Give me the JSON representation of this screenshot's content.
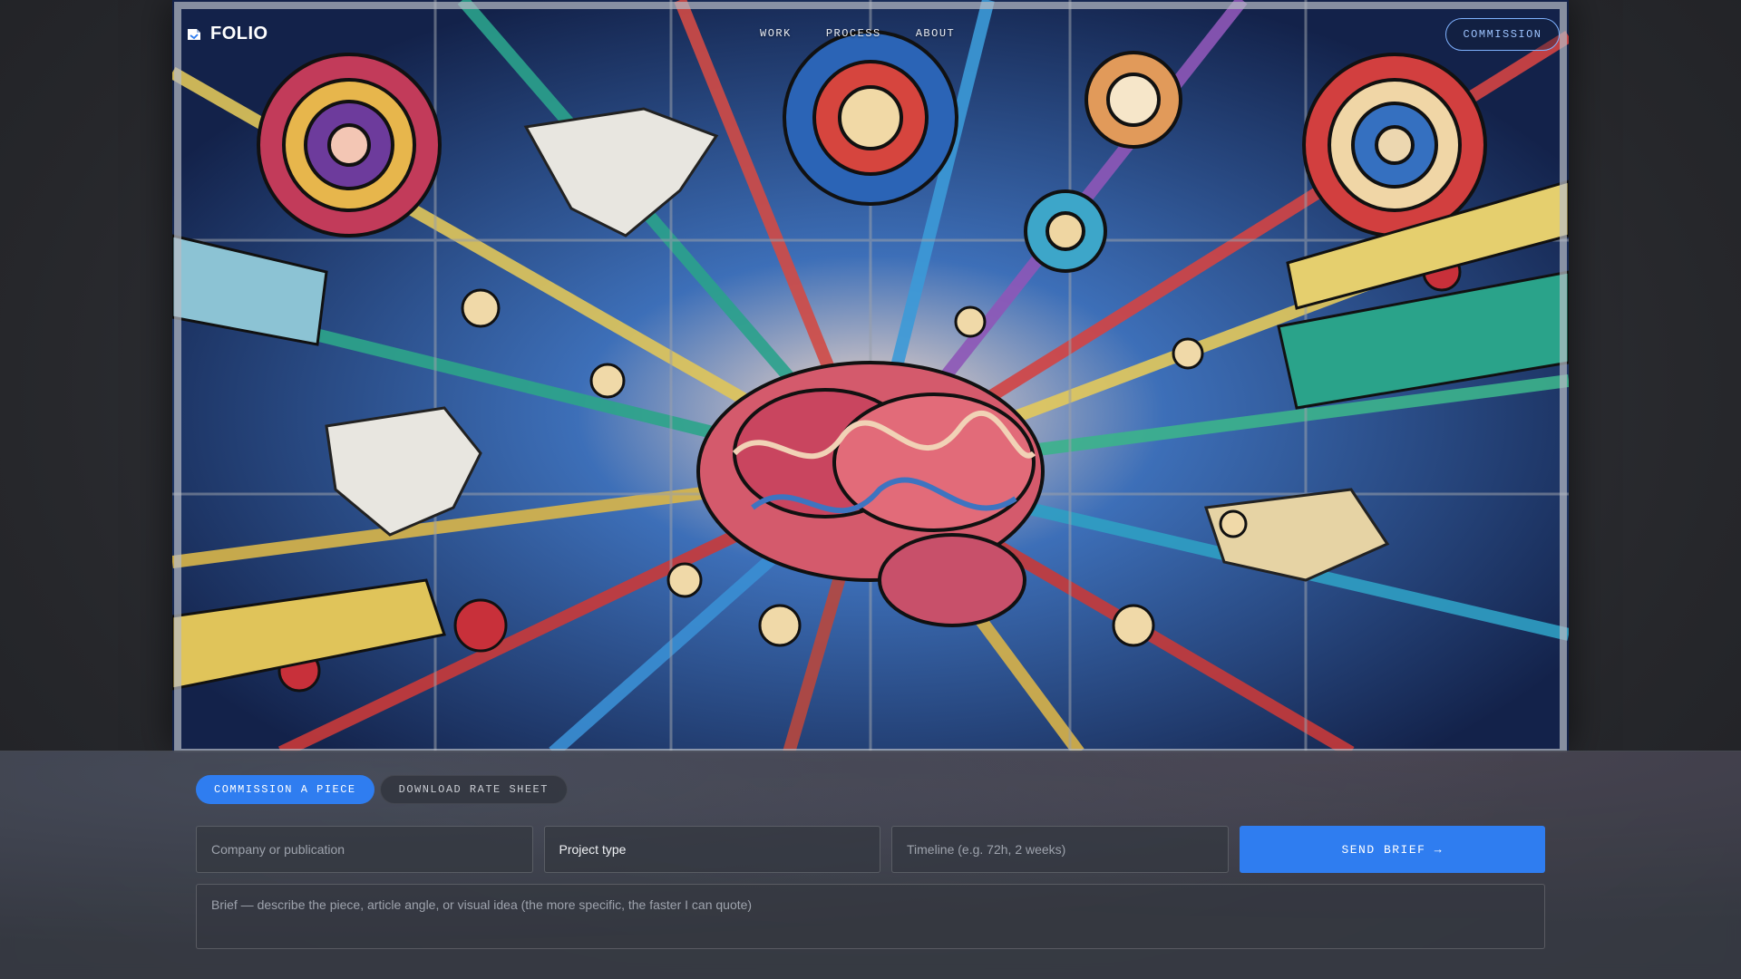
{
  "brand": {
    "name": "FOLIO",
    "logo_icon": "folded-page-icon"
  },
  "nav": {
    "items": [
      {
        "label": "WORK"
      },
      {
        "label": "PROCESS"
      },
      {
        "label": "ABOUT"
      }
    ],
    "cta_label": "COMMISSION"
  },
  "hero": {
    "image_alt": "stained-glass illustration of a brain with world maps and radiating lines"
  },
  "form": {
    "tabs": [
      {
        "label": "COMMISSION A PIECE",
        "active": true
      },
      {
        "label": "DOWNLOAD RATE SHEET",
        "active": false
      }
    ],
    "company_placeholder": "Company or publication",
    "company_value": "",
    "project_type_value": "Project type",
    "timeline_placeholder": "Timeline (e.g. 72h, 2 weeks)",
    "timeline_value": "",
    "send_label": "SEND BRIEF →",
    "brief_placeholder": "Brief — describe the piece, article angle, or visual idea (the more specific, the faster I can quote)",
    "brief_value": ""
  },
  "colors": {
    "accent": "#2f7df0",
    "cta_outline": "#7fb2ff",
    "panel_bg": "#3a3e48"
  }
}
